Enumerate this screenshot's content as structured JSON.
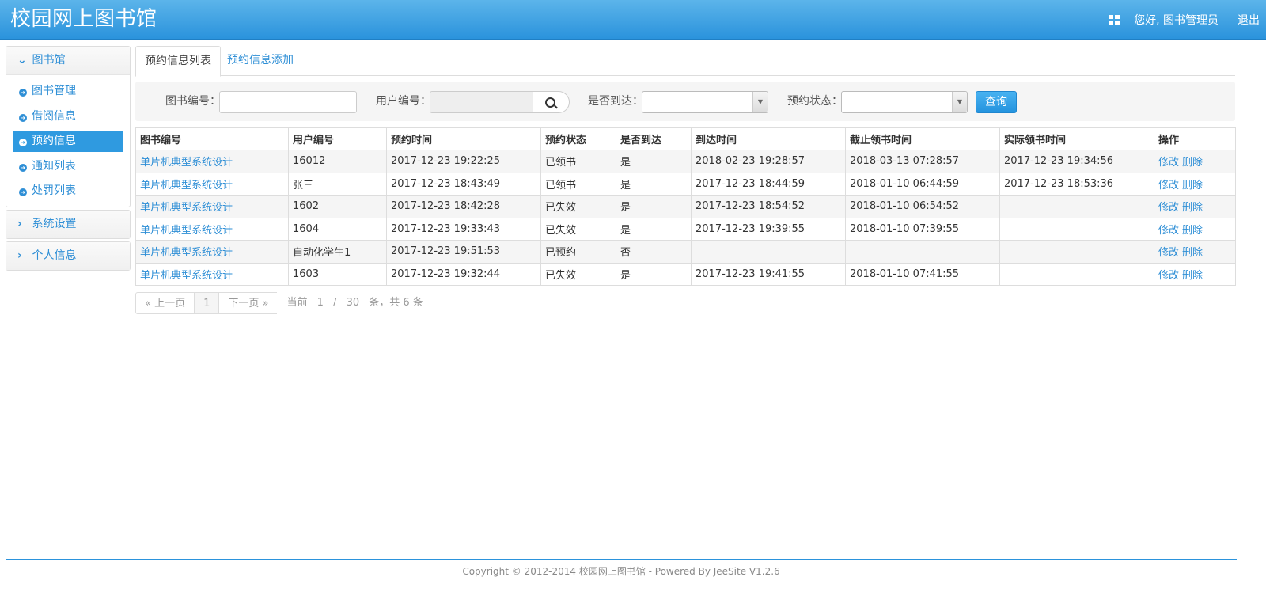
{
  "header": {
    "title": "校园网上图书馆",
    "welcome": "您好, 图书管理员",
    "logout": "退出",
    "icon": "grid-icon"
  },
  "sidebar": {
    "groups": [
      {
        "label": "图书馆",
        "expanded": true
      },
      {
        "label": "系统设置",
        "expanded": false
      },
      {
        "label": "个人信息",
        "expanded": false
      }
    ],
    "items": [
      {
        "label": "图书管理"
      },
      {
        "label": "借阅信息"
      },
      {
        "label": "预约信息",
        "active": true
      },
      {
        "label": "通知列表"
      },
      {
        "label": "处罚列表"
      }
    ]
  },
  "tabs": [
    {
      "label": "预约信息列表",
      "active": true
    },
    {
      "label": "预约信息添加"
    }
  ],
  "search": {
    "book_label": "图书编号：",
    "book_value": "",
    "user_label": "用户编号：",
    "user_value": "",
    "arrived_label": "是否到达：",
    "arrived_value": "",
    "status_label": "预约状态：",
    "status_value": "",
    "query_button": "查询"
  },
  "table": {
    "columns": [
      "图书编号",
      "用户编号",
      "预约时间",
      "预约状态",
      "是否到达",
      "到达时间",
      "截止领书时间",
      "实际领书时间",
      "操作"
    ],
    "rows": [
      {
        "book": "单片机典型系统设计",
        "user": "16012",
        "reserve_time": "2017-12-23 19:22:25",
        "status": "已领书",
        "arrived": "是",
        "arrive_time": "2018-02-23 19:28:57",
        "deadline": "2018-03-13 07:28:57",
        "picked": "2017-12-23 19:34:56"
      },
      {
        "book": "单片机典型系统设计",
        "user": "张三",
        "reserve_time": "2017-12-23 18:43:49",
        "status": "已领书",
        "arrived": "是",
        "arrive_time": "2017-12-23 18:44:59",
        "deadline": "2018-01-10 06:44:59",
        "picked": "2017-12-23 18:53:36"
      },
      {
        "book": "单片机典型系统设计",
        "user": "1602",
        "reserve_time": "2017-12-23 18:42:28",
        "status": "已失效",
        "arrived": "是",
        "arrive_time": "2017-12-23 18:54:52",
        "deadline": "2018-01-10 06:54:52",
        "picked": ""
      },
      {
        "book": "单片机典型系统设计",
        "user": "1604",
        "reserve_time": "2017-12-23 19:33:43",
        "status": "已失效",
        "arrived": "是",
        "arrive_time": "2017-12-23 19:39:55",
        "deadline": "2018-01-10 07:39:55",
        "picked": ""
      },
      {
        "book": "单片机典型系统设计",
        "user": "自动化学生1",
        "reserve_time": "2017-12-23 19:51:53",
        "status": "已预约",
        "arrived": "否",
        "arrive_time": "",
        "deadline": "",
        "picked": ""
      },
      {
        "book": "单片机典型系统设计",
        "user": "1603",
        "reserve_time": "2017-12-23 19:32:44",
        "status": "已失效",
        "arrived": "是",
        "arrive_time": "2017-12-23 19:41:55",
        "deadline": "2018-01-10 07:41:55",
        "picked": ""
      }
    ],
    "edit_label": "修改",
    "delete_label": "删除"
  },
  "pager": {
    "prev": "« 上一页",
    "current": "1",
    "next": "下一页 »",
    "info_prefix": "当前",
    "page_input": "1",
    "slash": "/",
    "page_size": "30",
    "info_suffix": "条，共 6 条"
  },
  "footer": {
    "copyright": "Copyright © 2012-2014 校园网上图书馆 - Powered By JeeSite V1.2.6"
  }
}
